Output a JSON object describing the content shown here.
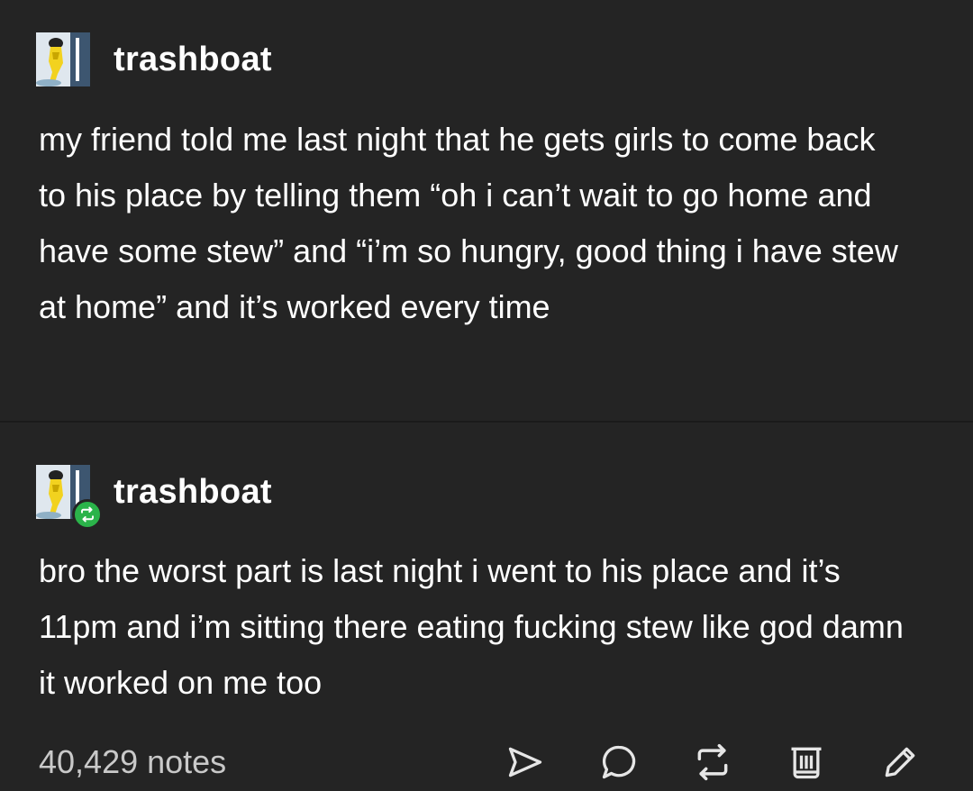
{
  "posts": [
    {
      "username": "trashboat",
      "body": "my friend told me last night that he gets girls to come back to his place by telling them “oh i can’t wait to go home and have some stew” and “i’m so hungry, good thing i have stew at home” and it’s worked every time"
    },
    {
      "username": "trashboat",
      "body": "bro the worst part is last night i went to his place and it’s 11pm and i’m sitting there eating fucking stew like god damn it worked on me too"
    }
  ],
  "footer": {
    "notes": "40,429 notes",
    "actions": [
      "share-icon",
      "reply-icon",
      "reblog-icon",
      "delete-icon",
      "edit-icon"
    ]
  },
  "colors": {
    "background": "#242424",
    "text": "#ffffff",
    "notes_text": "#c9c9c9",
    "reblog_badge": "#2bb34a"
  }
}
